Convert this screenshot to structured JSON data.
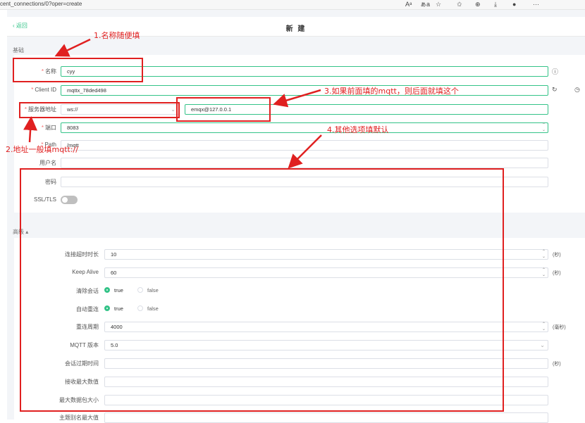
{
  "browser": {
    "url": "cent_connections/0?oper=create",
    "icons": [
      "font-size-icon",
      "translate-icon",
      "favorite-add-icon",
      "favorites-icon",
      "collections-icon",
      "downloads-icon",
      "profile-icon",
      "more-icon"
    ]
  },
  "header": {
    "back_label": "返回",
    "title": "新 建"
  },
  "basic": {
    "section_label": "基础",
    "name_label": "名称",
    "name_value": "cyy",
    "clientid_label": "Client ID",
    "clientid_value": "mqttx_78ded498",
    "server_label": "服务器地址",
    "protocol_value": "ws://",
    "host_value": "emqx@127.0.0.1",
    "port_label": "端口",
    "port_value": "8083",
    "path_label": "Path",
    "path_value": "/mqtt",
    "username_label": "用户名",
    "username_value": "",
    "password_label": "密码",
    "password_value": "",
    "ssl_label": "SSL/TLS",
    "ssl_on": false
  },
  "advanced": {
    "section_label": "高级",
    "connect_timeout_label": "连接超时时长",
    "connect_timeout_value": "10",
    "connect_timeout_unit": "(秒)",
    "keepalive_label": "Keep Alive",
    "keepalive_value": "60",
    "keepalive_unit": "(秒)",
    "clean_session_label": "清除会话",
    "true_label": "true",
    "false_label": "false",
    "auto_reconnect_label": "自动重连",
    "reconnect_period_label": "重连周期",
    "reconnect_period_value": "4000",
    "reconnect_period_unit": "(毫秒)",
    "mqtt_version_label": "MQTT 版本",
    "mqtt_version_value": "5.0",
    "session_expiry_label": "会话过期时间",
    "session_expiry_unit": "(秒)",
    "receive_max_label": "接收最大数值",
    "max_packet_label": "最大数据包大小",
    "topic_alias_label": "主题别名最大值"
  },
  "annotations": {
    "a1": "1.名称随便填",
    "a2": "2.地址一般填mqtt://",
    "a3": "3.如果前面填的mqtt，则后面就填这个",
    "a4": "4.其他选项填默认"
  },
  "colors": {
    "accent": "#34c388",
    "annotation": "#e02020",
    "required": "#f56c6c"
  }
}
